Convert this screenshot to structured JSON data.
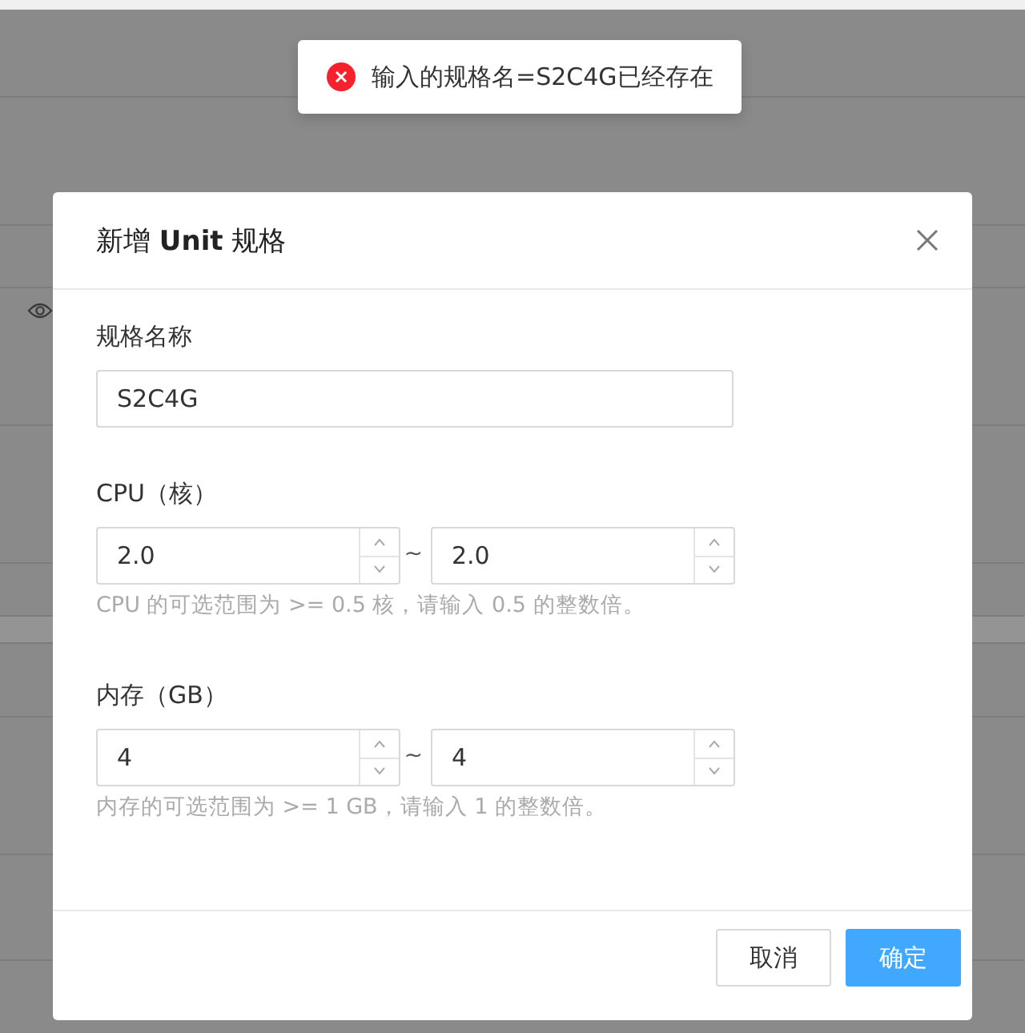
{
  "toast": {
    "kind": "error",
    "message": "输入的规格名=S2C4G已经存在"
  },
  "modal": {
    "title": "新增 **Unit** 规格",
    "fields": [
      {
        "kind": "text",
        "label": "规格名称",
        "value": "S2C4G"
      },
      {
        "kind": "range",
        "label": "CPU（核）",
        "min": "2.0",
        "separator": "~",
        "max": "2.0",
        "help": "CPU 的可选范围为 >= 0.5 核，请输入 0.5 的整数倍。"
      },
      {
        "kind": "range",
        "label": "内存（GB）",
        "min": "4",
        "separator": "~",
        "max": "4",
        "help": "内存的可选范围为 >= 1 GB，请输入 1 的整数倍。"
      }
    ],
    "buttons": [
      {
        "label": "取消",
        "primary": false
      },
      {
        "label": "确定",
        "primary": true
      }
    ]
  }
}
